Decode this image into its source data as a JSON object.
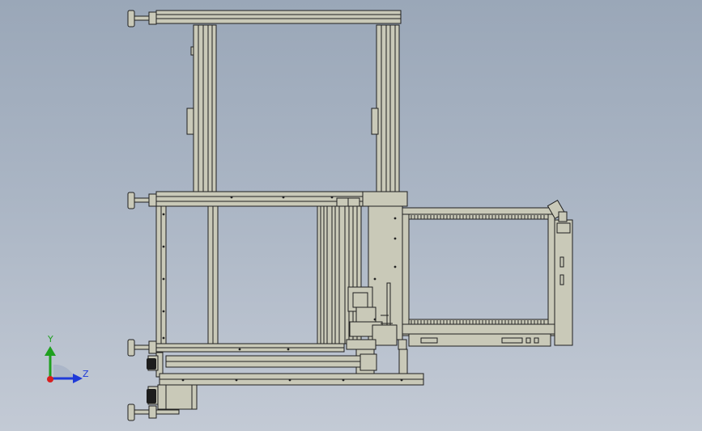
{
  "axes": {
    "y_label": "Y",
    "z_label": "Z"
  },
  "colors": {
    "background_top": "#9aa7b8",
    "background_bottom": "#c3cad5",
    "part_fill": "#c9c9b8",
    "part_stroke": "#1f1f1f",
    "axis_y": "#1fa01f",
    "axis_z": "#1f3ad8",
    "origin": "#d81f1f"
  }
}
